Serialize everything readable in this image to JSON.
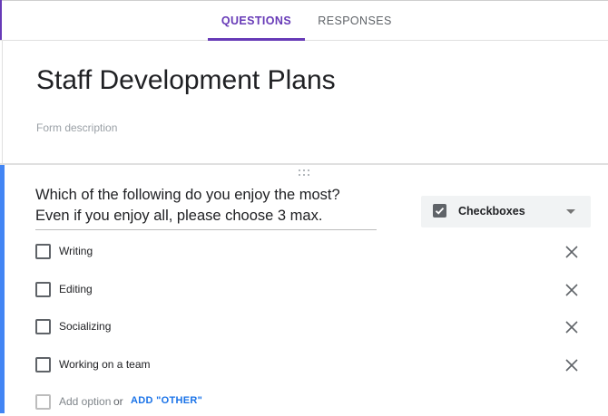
{
  "tabs": [
    {
      "label": "QUESTIONS",
      "active": true
    },
    {
      "label": "RESPONSES",
      "active": false
    }
  ],
  "form": {
    "title": "Staff Development Plans",
    "description_placeholder": "Form description"
  },
  "question": {
    "title_line1": "Which of the following do you enjoy the most?",
    "title_line2": "Even if you enjoy all, please choose 3 max.",
    "type": {
      "label": "Checkboxes",
      "icon": "checkbox-checked-icon"
    },
    "options": [
      {
        "label": "Writing"
      },
      {
        "label": "Editing"
      },
      {
        "label": "Socializing"
      },
      {
        "label": "Working on a team"
      }
    ],
    "add_option_label": "Add option",
    "or_label": "or",
    "add_other_label": "ADD \"OTHER\""
  },
  "colors": {
    "accent": "#673ab7",
    "focus_bar": "#4285f4",
    "link": "#1a73e8"
  },
  "icons": {
    "drag": "drag-handle-icon",
    "remove": "close-icon",
    "dropdown": "chevron-down-icon"
  }
}
